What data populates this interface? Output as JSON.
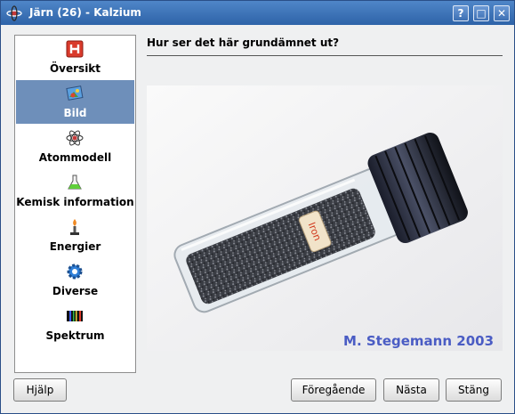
{
  "window": {
    "title": "Järn (26) - Kalzium",
    "buttons": {
      "help": "?",
      "maximize": "□",
      "close": "✕"
    }
  },
  "sidebar": {
    "items": [
      {
        "label": "Översikt",
        "icon": "overview-icon"
      },
      {
        "label": "Bild",
        "icon": "picture-icon",
        "selected": true
      },
      {
        "label": "Atommodell",
        "icon": "atom-icon"
      },
      {
        "label": "Kemisk information",
        "icon": "flask-icon"
      },
      {
        "label": "Energier",
        "icon": "bunsen-burner-icon"
      },
      {
        "label": "Diverse",
        "icon": "gear-icon"
      },
      {
        "label": "Spektrum",
        "icon": "spectrum-icon"
      }
    ]
  },
  "main": {
    "heading": "Hur ser det här grundämnet ut?",
    "photo": {
      "vial_label": "Iron",
      "credit": "M. Stegemann 2003"
    }
  },
  "footer": {
    "help_label": "Hjälp",
    "prev_label": "Föregående",
    "next_label": "Nästa",
    "close_label": "Stäng"
  },
  "colors": {
    "titlebar": "#2e63a8",
    "selection": "#6e8fba",
    "element_red": "#d93a2b"
  }
}
